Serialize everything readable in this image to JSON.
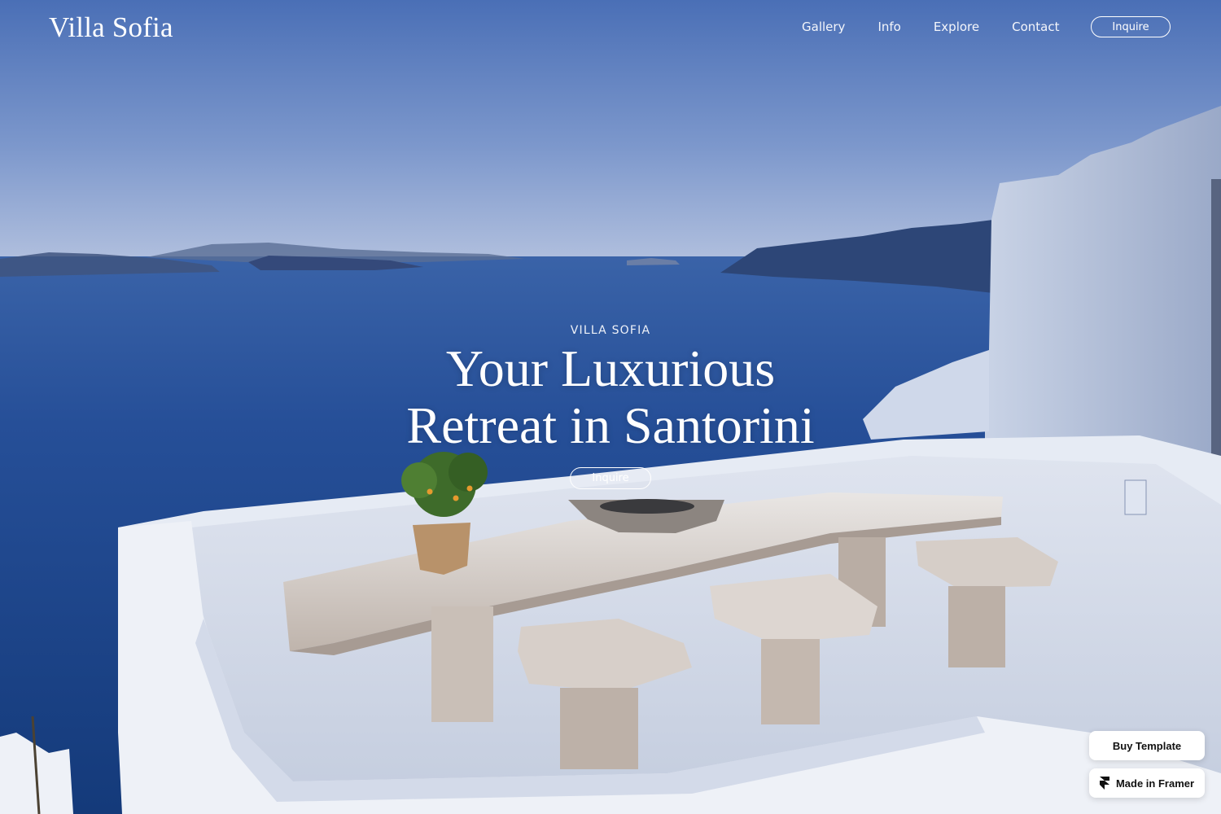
{
  "header": {
    "logo": "Villa Sofia",
    "nav": [
      "Gallery",
      "Info",
      "Explore",
      "Contact"
    ],
    "inquire_label": "Inquire"
  },
  "hero": {
    "eyebrow": "VILLA SOFIA",
    "headline_line1": "Your Luxurious",
    "headline_line2": "Retreat in Santorini",
    "cta_label": "Inquire",
    "background_image": "Santorini terrace with wooden table and stools overlooking the caldera sea"
  },
  "badges": {
    "buy_label": "Buy Template",
    "framer_label": "Made in Framer",
    "framer_icon": "framer-logo-icon"
  },
  "colors": {
    "sky_top": "#4a72b8",
    "sky_horizon": "#a8b9d9",
    "sea": "#1f4a93",
    "terrace": "#e8ecf4"
  }
}
